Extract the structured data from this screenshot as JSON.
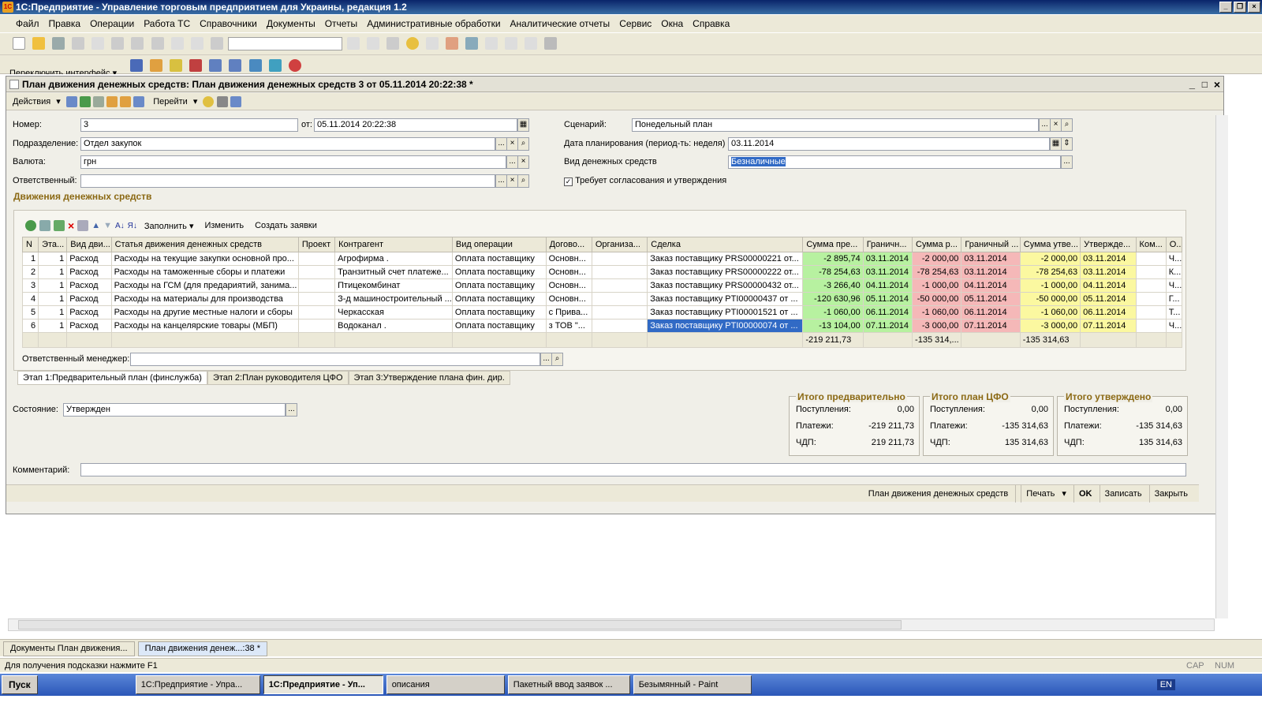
{
  "app": {
    "title": "1С:Предприятие - Управление торговым предприятием для Украины, редакция 1.2"
  },
  "menu": [
    "Файл",
    "Правка",
    "Операции",
    "Работа ТС",
    "Справочники",
    "Документы",
    "Отчеты",
    "Административные обработки",
    "Аналитические отчеты",
    "Сервис",
    "Окна",
    "Справка"
  ],
  "toolbar2": {
    "switch_label": "Переключить интерфейс"
  },
  "doc": {
    "title": "План движения денежных средств: План движения денежных средств 3 от 05.11.2014 20:22:38 *",
    "toolbar": {
      "actions": "Действия",
      "goto": "Перейти"
    },
    "fields": {
      "number_label": "Номер:",
      "number": "3",
      "date_label": "от:",
      "date": "05.11.2014 20:22:38",
      "dept_label": "Подразделение:",
      "dept": "Отдел закупок",
      "currency_label": "Валюта:",
      "currency": "грн",
      "resp_label": "Ответственный:",
      "resp": "",
      "scenario_label": "Сценарий:",
      "scenario": "Понедельный план",
      "plandate_label": "Дата планирования (период-ть: неделя)",
      "plandate": "03.11.2014",
      "cashtype_label": "Вид денежных средств",
      "cashtype": "Безналичные",
      "approval_label": "Требует согласования и утверждения"
    },
    "section_title": "Движения денежных средств",
    "table_toolbar": {
      "fill": "Заполнить",
      "edit": "Изменить",
      "create": "Создать заявки"
    },
    "table": {
      "headers": [
        "N",
        "Эта...",
        "Вид дви...",
        "Статья движения денежных средств",
        "Проект",
        "Контрагент",
        "Вид операции",
        "Догово...",
        "Организа...",
        "Сделка",
        "Сумма пре...",
        "Граничн...",
        "Сумма р...",
        "Граничный ...",
        "Сумма утве...",
        "Утвержде...",
        "Ком...",
        "О..."
      ],
      "rows": [
        [
          "1",
          "1",
          "Расход",
          "Расходы на текущие закупки основной про...",
          "",
          "Агрофирма .",
          "Оплата поставщику",
          "Основн...",
          "",
          "Заказ поставщику PRS00000221 от...",
          "-2 895,74",
          "03.11.2014",
          "-2 000,00",
          "03.11.2014",
          "-2 000,00",
          "03.11.2014",
          "",
          "Ч..."
        ],
        [
          "2",
          "1",
          "Расход",
          "Расходы на таможенные сборы и платежи",
          "",
          "Транзитный счет платеже...",
          "Оплата поставщику",
          "Основн...",
          "",
          "Заказ поставщику PRS00000222 от...",
          "-78 254,63",
          "03.11.2014",
          "-78 254,63",
          "03.11.2014",
          "-78 254,63",
          "03.11.2014",
          "",
          "К..."
        ],
        [
          "3",
          "1",
          "Расход",
          "Расходы на ГСМ (для предариятий, занима...",
          "",
          "Птицекомбинат",
          "Оплата поставщику",
          "Основн...",
          "",
          "Заказ поставщику PRS00000432 от...",
          "-3 266,40",
          "04.11.2014",
          "-1 000,00",
          "04.11.2014",
          "-1 000,00",
          "04.11.2014",
          "",
          "Ч..."
        ],
        [
          "4",
          "1",
          "Расход",
          "Расходы на материалы для производства",
          "",
          "З-д машиностроительный ...",
          "Оплата поставщику",
          "Основн...",
          "",
          "Заказ поставщику PTI00000437 от ...",
          "-120 630,96",
          "05.11.2014",
          "-50 000,00",
          "05.11.2014",
          "-50 000,00",
          "05.11.2014",
          "",
          "Г..."
        ],
        [
          "5",
          "1",
          "Расход",
          "Расходы на другие местные налоги и сборы",
          "",
          "Черкасская",
          "Оплата поставщику",
          "с Прива...",
          "",
          "Заказ поставщику PTI00001521 от ...",
          "-1 060,00",
          "06.11.2014",
          "-1 060,00",
          "06.11.2014",
          "-1 060,00",
          "06.11.2014",
          "",
          "Т..."
        ],
        [
          "6",
          "1",
          "Расход",
          "Расходы на канцелярские товары (МБП)",
          "",
          "Водоканал .",
          "Оплата поставщику",
          "з ТОВ \"...",
          "",
          "Заказ поставщику PTI00000074 от ...",
          "-13 104,00",
          "07.11.2014",
          "-3 000,00",
          "07.11.2014",
          "-3 000,00",
          "07.11.2014",
          "",
          "Ч..."
        ]
      ],
      "totals": {
        "prelim": "-219 211,73",
        "cfo": "-135 314,...",
        "approved": "-135 314,63"
      }
    },
    "manager_label": "Ответственный менеджер:",
    "tabs": [
      "Этап 1:Предварительный план (финслужба)",
      "Этап 2:План руководителя ЦФО",
      "Этап 3:Утверждение плана фин. дир."
    ],
    "state_label": "Состояние:",
    "state": "Утвержден",
    "summary": [
      {
        "title": "Итого предварительно",
        "in": "0,00",
        "out": "-219 211,73",
        "net": "219 211,73"
      },
      {
        "title": "Итого план ЦФО",
        "in": "0,00",
        "out": "-135 314,63",
        "net": "135 314,63"
      },
      {
        "title": "Итого утверждено",
        "in": "0,00",
        "out": "-135 314,63",
        "net": "135 314,63"
      }
    ],
    "summary_labels": {
      "in": "Поступления:",
      "out": "Платежи:",
      "net": "ЧДП:"
    },
    "comment_label": "Комментарий:",
    "bottom": {
      "plan": "План движения денежных средств",
      "print": "Печать",
      "ok": "OK",
      "save": "Записать",
      "close": "Закрыть"
    }
  },
  "wintabs": [
    "Документы План движения...",
    "План движения денеж...:38 *"
  ],
  "status": {
    "hint": "Для получения подсказки нажмите F1",
    "cap": "CAP",
    "num": "NUM"
  },
  "taskbar": {
    "start": "Пуск",
    "tasks": [
      "1С:Предприятие - Упра...",
      "1С:Предприятие - Уп...",
      "описания",
      "Пакетный ввод заявок ...",
      "Безымянный - Paint"
    ],
    "lang": "EN"
  }
}
